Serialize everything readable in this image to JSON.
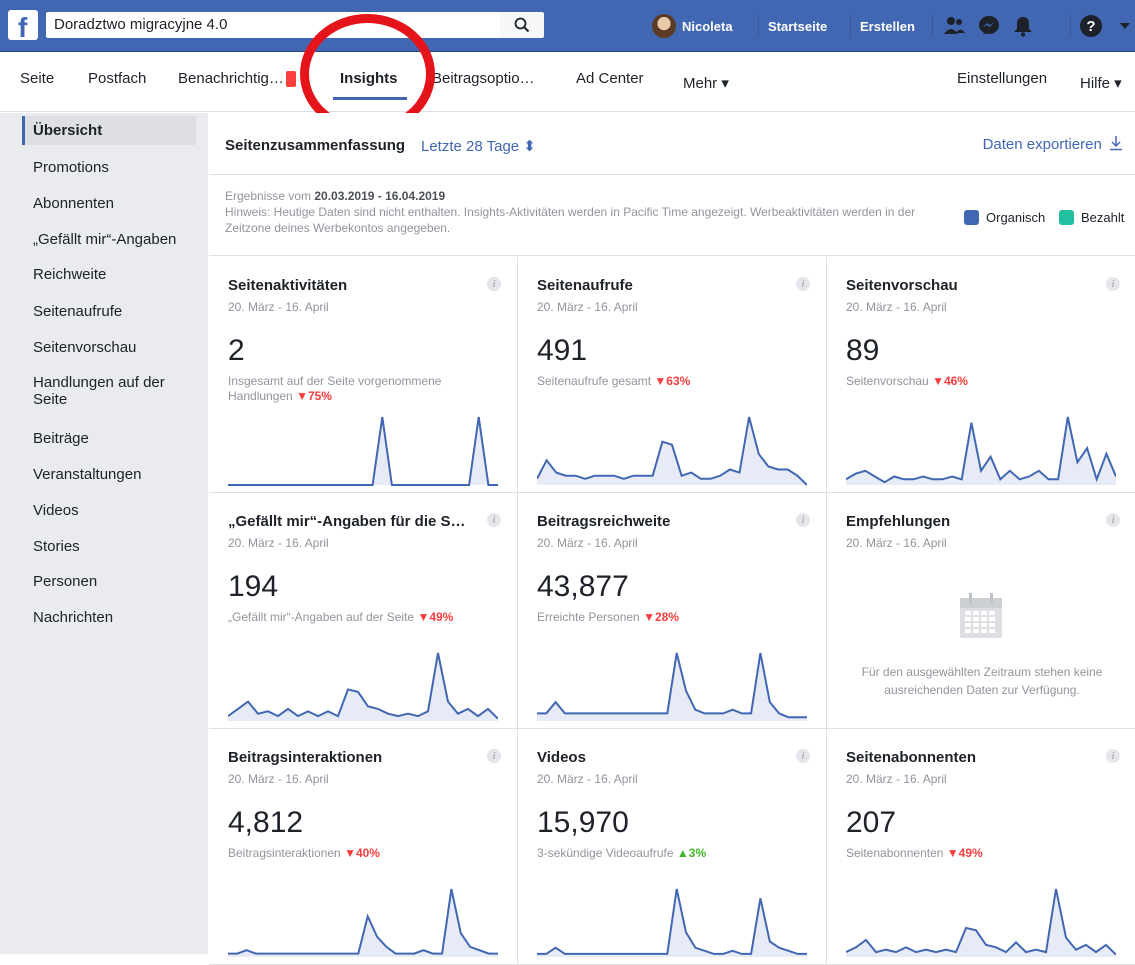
{
  "topbar": {
    "search_value": "Doradztwo migracyjne 4.0",
    "user_name": "Nicoleta",
    "home_label": "Startseite",
    "create_label": "Erstellen",
    "help_icon": "?"
  },
  "pagenav": {
    "seite": "Seite",
    "postfach": "Postfach",
    "benachrichtigungen": "Benachrichtig…",
    "insights": "Insights",
    "beitragsoptionen": "Beitragsoptio…",
    "ad_center": "Ad Center",
    "mehr": "Mehr ▾",
    "einstellungen": "Einstellungen",
    "hilfe": "Hilfe ▾"
  },
  "sidebar": {
    "items": [
      "Übersicht",
      "Promotions",
      "Abonnenten",
      "„Gefällt mir“-Angaben",
      "Reichweite",
      "Seitenaufrufe",
      "Seitenvorschau",
      "Handlungen auf der Seite",
      "Beiträge",
      "Veranstaltungen",
      "Videos",
      "Stories",
      "Personen",
      "Nachrichten"
    ]
  },
  "summary": {
    "title": "Seitenzusammenfassung",
    "range": "Letzte 28 Tage ⬍",
    "export": "Daten exportieren",
    "results_prefix": "Ergebnisse vom ",
    "results_range": "20.03.2019 - 16.04.2019",
    "note": "Hinweis: Heutige Daten sind nicht enthalten. Insights-Aktivitäten werden in Pacific Time angezeigt. Werbeaktivitäten werden in der Zeitzone deines Werbekontos angegeben.",
    "legend_organic": "Organisch",
    "legend_paid": "Bezahlt",
    "color_organic": "#4267b2",
    "color_paid": "#20c0a0"
  },
  "cards": [
    {
      "title": "Seitenaktivitäten",
      "date": "20. März - 16. April",
      "value": "2",
      "sub": "Insgesamt auf der Seite vorgenommene Handlungen",
      "change": "▼75%",
      "dir": "down",
      "spark": [
        0,
        0,
        0,
        0,
        0,
        0,
        0,
        0,
        0,
        0,
        0,
        0,
        0,
        0,
        0,
        0,
        10,
        0,
        0,
        0,
        0,
        0,
        0,
        0,
        0,
        0,
        10,
        0,
        0
      ]
    },
    {
      "title": "Seitenaufrufe",
      "date": "20. März - 16. April",
      "value": "491",
      "sub": "Seitenaufrufe gesamt",
      "change": "▼63%",
      "dir": "down",
      "spark": [
        2,
        8,
        4,
        3,
        3,
        2,
        3,
        3,
        3,
        2,
        3,
        3,
        3,
        14,
        13,
        3,
        4,
        2,
        2,
        3,
        5,
        4,
        22,
        10,
        6,
        5,
        5,
        3,
        0
      ]
    },
    {
      "title": "Seitenvorschau",
      "date": "20. März - 16. April",
      "value": "89",
      "sub": "Seitenvorschau",
      "change": "▼46%",
      "dir": "down",
      "spark": [
        2,
        4,
        5,
        3,
        1,
        3,
        2,
        2,
        3,
        2,
        2,
        3,
        2,
        22,
        5,
        10,
        2,
        5,
        2,
        3,
        5,
        2,
        2,
        24,
        8,
        13,
        2,
        11,
        3
      ]
    },
    {
      "title": "„Gefällt mir“-Angaben für die S…",
      "date": "20. März - 16. April",
      "value": "194",
      "sub": "„Gefällt mir“-Angaben auf der Seite",
      "change": "▼49%",
      "dir": "down",
      "spark": [
        2,
        5,
        8,
        3,
        4,
        2,
        5,
        2,
        4,
        2,
        4,
        2,
        13,
        12,
        6,
        5,
        3,
        2,
        3,
        2,
        4,
        28,
        8,
        3,
        5,
        2,
        5,
        1
      ]
    },
    {
      "title": "Beitragsreichweite",
      "date": "20. März - 16. April",
      "value": "43,877",
      "sub": "Erreichte Personen",
      "change": "▼28%",
      "dir": "down",
      "spark": [
        2,
        2,
        5,
        2,
        2,
        2,
        2,
        2,
        2,
        2,
        2,
        2,
        2,
        2,
        2,
        18,
        8,
        3,
        2,
        2,
        2,
        3,
        2,
        2,
        18,
        5,
        2,
        1,
        1,
        1
      ]
    },
    {
      "title": "Empfehlungen",
      "date": "20. März - 16. April",
      "value": "",
      "sub": "",
      "change": "",
      "dir": "none",
      "empty": "Für den ausgewählten Zeitraum stehen keine ausreichenden Daten zur Verfügung.",
      "spark": []
    },
    {
      "title": "Beitragsinteraktionen",
      "date": "20. März - 16. April",
      "value": "4,812",
      "sub": "Beitragsinteraktionen",
      "change": "▼40%",
      "dir": "down",
      "spark": [
        1,
        1,
        2,
        1,
        1,
        1,
        1,
        1,
        1,
        1,
        1,
        1,
        1,
        1,
        1,
        12,
        6,
        3,
        1,
        1,
        1,
        2,
        1,
        1,
        20,
        7,
        3,
        2,
        1,
        1
      ]
    },
    {
      "title": "Videos",
      "date": "20. März - 16. April",
      "value": "15,970",
      "sub": "3-sekündige Videoaufrufe",
      "change": "▲3%",
      "dir": "up",
      "spark": [
        1,
        1,
        3,
        1,
        1,
        1,
        1,
        1,
        1,
        1,
        1,
        1,
        1,
        1,
        1,
        22,
        8,
        3,
        2,
        1,
        1,
        2,
        1,
        1,
        19,
        5,
        3,
        2,
        1,
        1
      ]
    },
    {
      "title": "Seitenabonnenten",
      "date": "20. März - 16. April",
      "value": "207",
      "sub": "Seitenabonnenten",
      "change": "▼49%",
      "dir": "down",
      "spark": [
        2,
        4,
        7,
        2,
        3,
        2,
        4,
        2,
        3,
        2,
        3,
        2,
        12,
        11,
        5,
        4,
        2,
        6,
        2,
        3,
        2,
        28,
        8,
        3,
        5,
        2,
        5,
        1
      ]
    }
  ]
}
